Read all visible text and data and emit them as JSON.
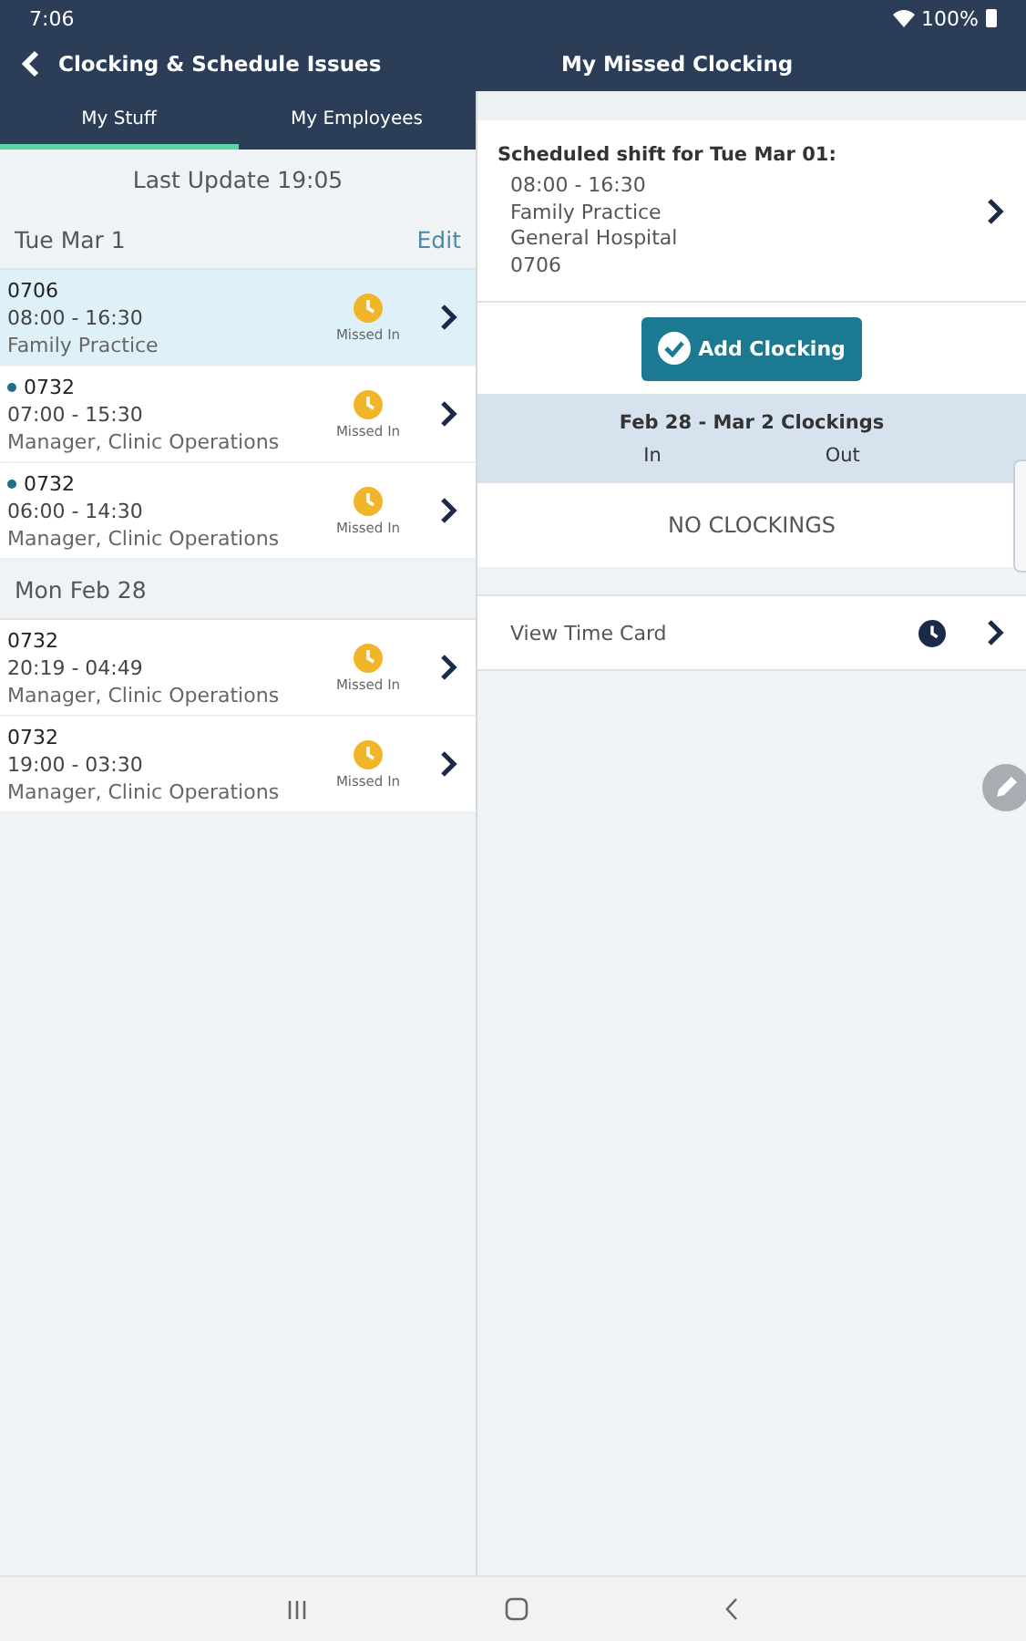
{
  "status_bar": {
    "time": "7:06",
    "battery": "100%"
  },
  "header": {
    "title": "Clocking & Schedule Issues",
    "detail_title": "My Missed Clocking"
  },
  "tabs": [
    {
      "label": "My Stuff",
      "selected": true
    },
    {
      "label": "My Employees",
      "selected": false
    }
  ],
  "last_update": "Last Update 19:05",
  "groups": [
    {
      "date": "Tue Mar 1",
      "action": "Edit",
      "items": [
        {
          "code": "0706",
          "time": "08:00 - 16:30",
          "role": "Family Practice",
          "status": "Missed In",
          "unread": false,
          "selected": true
        },
        {
          "code": "0732",
          "time": "07:00 - 15:30",
          "role": "Manager, Clinic Operations",
          "status": "Missed In",
          "unread": true,
          "selected": false
        },
        {
          "code": "0732",
          "time": "06:00 - 14:30",
          "role": "Manager, Clinic Operations",
          "status": "Missed In",
          "unread": true,
          "selected": false
        }
      ]
    },
    {
      "date": "Mon Feb 28",
      "items": [
        {
          "code": "0732",
          "time": "20:19 - 04:49",
          "role": "Manager, Clinic Operations",
          "status": "Missed In",
          "unread": false,
          "selected": false
        },
        {
          "code": "0732",
          "time": "19:00 - 03:30",
          "role": "Manager, Clinic Operations",
          "status": "Missed In",
          "unread": false,
          "selected": false
        }
      ]
    }
  ],
  "detail": {
    "shift_heading": "Scheduled shift for Tue Mar 01:",
    "shift_lines": [
      "08:00 - 16:30",
      "Family Practice",
      "General Hospital",
      "0706"
    ],
    "add_button": "Add Clocking",
    "clockings_title": "Feb 28 - Mar 2 Clockings",
    "columns": [
      "In",
      "Out"
    ],
    "empty": "NO CLOCKINGS",
    "time_card": "View Time Card"
  }
}
